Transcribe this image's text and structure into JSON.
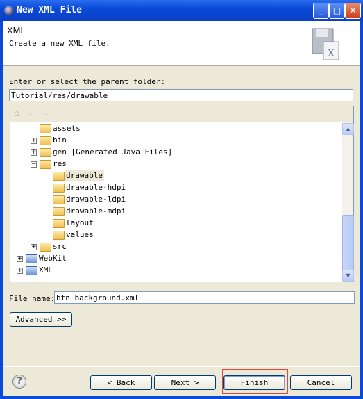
{
  "window": {
    "title": "New XML File",
    "minimize": "_",
    "maximize": "□",
    "close": "✕"
  },
  "header": {
    "title": "XML",
    "description": "Create a new XML file."
  },
  "parent_folder": {
    "label": "Enter or select the parent folder:",
    "value": "Tutorial/res/drawable"
  },
  "tree": {
    "toolbar": [
      "home-icon",
      "back-arrow-icon",
      "forward-arrow-icon"
    ],
    "items": [
      {
        "label": "assets",
        "expander": ""
      },
      {
        "label": "bin",
        "expander": "+"
      },
      {
        "label": "gen [Generated Java Files]",
        "expander": "+"
      },
      {
        "label": "res",
        "expander": "-"
      },
      {
        "label": "drawable",
        "selected": true
      },
      {
        "label": "drawable-hdpi"
      },
      {
        "label": "drawable-ldpi"
      },
      {
        "label": "drawable-mdpi"
      },
      {
        "label": "layout"
      },
      {
        "label": "values"
      },
      {
        "label": "src",
        "expander": "+"
      },
      {
        "label": "WebKit",
        "expander": "+"
      },
      {
        "label": "XML",
        "expander": "+"
      }
    ]
  },
  "file_name": {
    "label": "File name:",
    "value": "btn_background.xml"
  },
  "advanced_label": "Advanced >>",
  "buttons": {
    "help": "?",
    "back": "< Back",
    "next": "Next >",
    "finish": "Finish",
    "cancel": "Cancel"
  },
  "highlight_color": "#e0463c"
}
